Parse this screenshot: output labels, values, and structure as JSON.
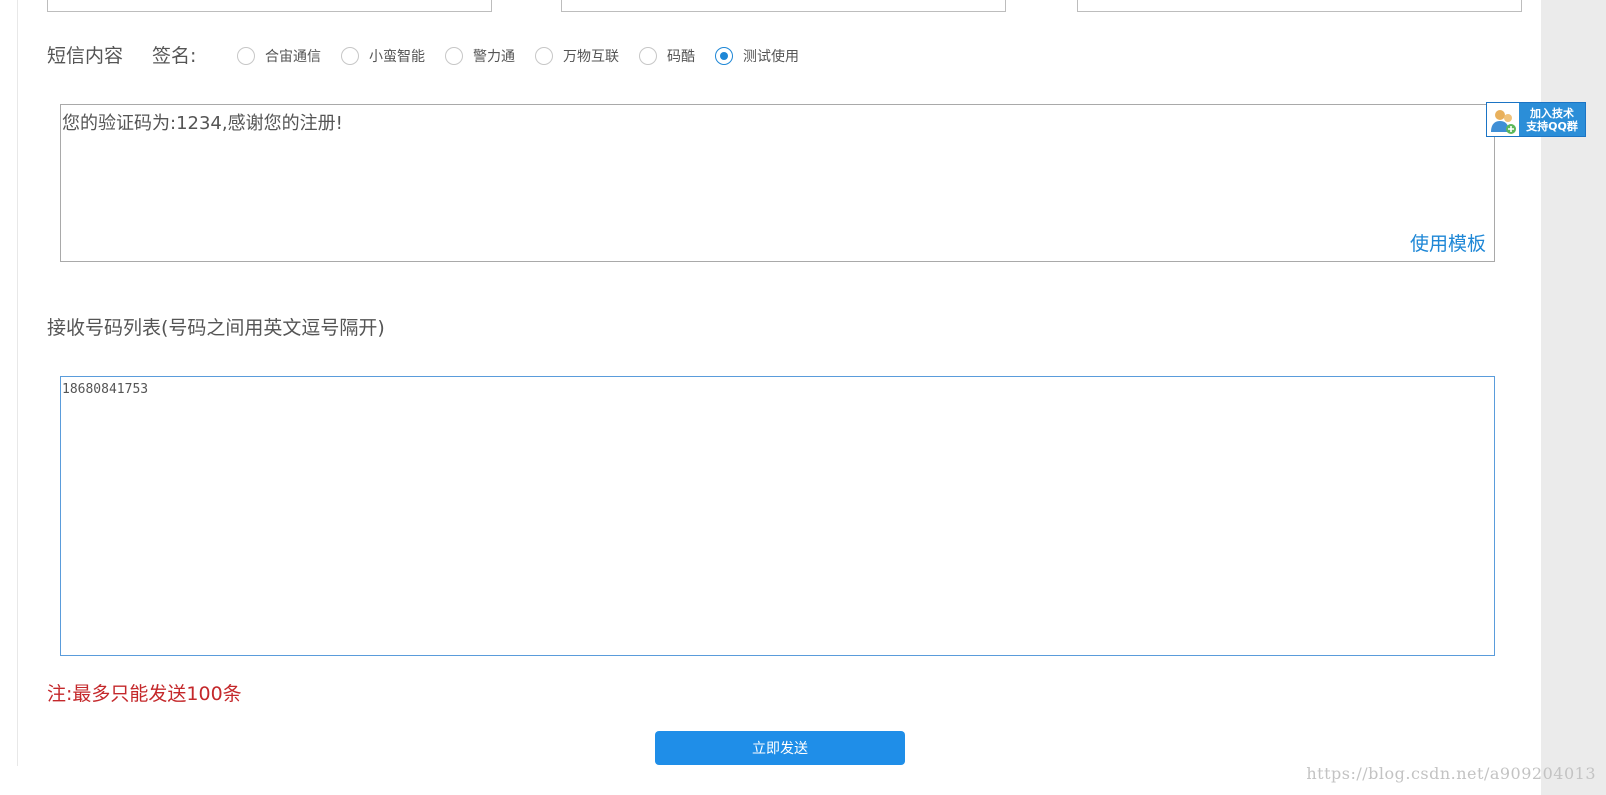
{
  "sms": {
    "section_label": "短信内容",
    "signature_label": "签名:",
    "signatures": [
      {
        "label": "合宙通信",
        "checked": false
      },
      {
        "label": "小蛮智能",
        "checked": false
      },
      {
        "label": "警力通",
        "checked": false
      },
      {
        "label": "万物互联",
        "checked": false
      },
      {
        "label": "码酷",
        "checked": false
      },
      {
        "label": "测试使用",
        "checked": true
      }
    ],
    "content": "您的验证码为:1234,感谢您的注册!",
    "template_link": "使用模板"
  },
  "recipients": {
    "label": "接收号码列表(号码之间用英文逗号隔开)",
    "value": "18680841753"
  },
  "note": "注:最多只能发送100条",
  "send_button": "立即发送",
  "qq_widget": {
    "text": "加入技术\n支持QQ群"
  },
  "watermark": "https://blog.csdn.net/a909204013",
  "colors": {
    "accent": "#1f8ee8",
    "link": "#1e87d6",
    "note": "#c4282b"
  }
}
